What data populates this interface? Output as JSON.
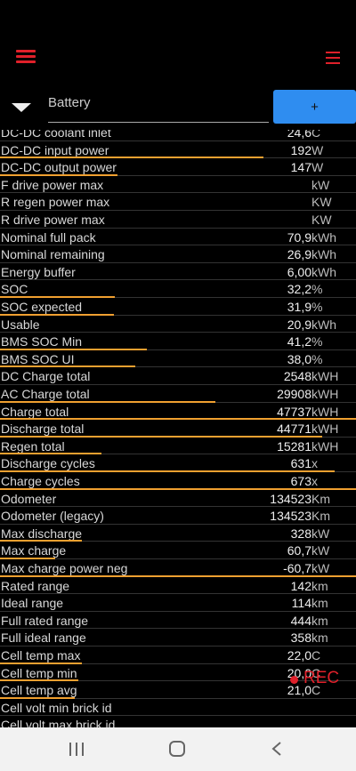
{
  "selector": {
    "current": "Battery",
    "add_label": "+"
  },
  "rows": [
    {
      "label": "DC-DC coolant inlet",
      "value": "24,6",
      "unit": "C",
      "bar": 0
    },
    {
      "label": "DC-DC input power",
      "value": "192",
      "unit": "W",
      "bar": 0.74
    },
    {
      "label": "DC-DC output power",
      "value": "147",
      "unit": "W",
      "bar": 0.33
    },
    {
      "label": "F drive power max",
      "value": "",
      "unit": "kW",
      "bar": 0
    },
    {
      "label": "R regen power max",
      "value": "",
      "unit": "KW",
      "bar": 0
    },
    {
      "label": "R drive power max",
      "value": "",
      "unit": "KW",
      "bar": 0
    },
    {
      "label": "Nominal full pack",
      "value": "70,9",
      "unit": "kWh",
      "bar": 0
    },
    {
      "label": "Nominal remaining",
      "value": "26,9",
      "unit": "kWh",
      "bar": 0
    },
    {
      "label": "Energy buffer",
      "value": "6,00",
      "unit": "kWh",
      "bar": 0
    },
    {
      "label": "SOC",
      "value": "32,2",
      "unit": "%",
      "bar": 0.322
    },
    {
      "label": "SOC expected",
      "value": "31,9",
      "unit": "%",
      "bar": 0.319
    },
    {
      "label": "Usable",
      "value": "20,9",
      "unit": "kWh",
      "bar": 0
    },
    {
      "label": "BMS SOC Min",
      "value": "41,2",
      "unit": "%",
      "bar": 0.412
    },
    {
      "label": "BMS SOC UI",
      "value": "38,0",
      "unit": "%",
      "bar": 0.38
    },
    {
      "label": "DC Charge total",
      "value": "2548",
      "unit": "kWH",
      "bar": 0
    },
    {
      "label": "AC Charge total",
      "value": "29908",
      "unit": "kWH",
      "bar": 0.605
    },
    {
      "label": "Charge total",
      "value": "47737",
      "unit": "kWH",
      "bar": 1.0
    },
    {
      "label": "Discharge total",
      "value": "44771",
      "unit": "kWH",
      "bar": 0.905
    },
    {
      "label": "Regen total",
      "value": "15281",
      "unit": "kWH",
      "bar": 0.285
    },
    {
      "label": "Discharge cycles",
      "value": "631",
      "unit": "x",
      "bar": 0.94
    },
    {
      "label": "Charge cycles",
      "value": "673",
      "unit": "x",
      "bar": 1.0
    },
    {
      "label": "Odometer",
      "value": "134523",
      "unit": "Km",
      "bar": 0
    },
    {
      "label": "Odometer (legacy)",
      "value": "134523",
      "unit": "Km",
      "bar": 0
    },
    {
      "label": "Max discharge",
      "value": "328",
      "unit": "kW",
      "bar": 0.23
    },
    {
      "label": "Max charge",
      "value": "60,7",
      "unit": "kW",
      "bar": 0.155
    },
    {
      "label": "Max charge power neg",
      "value": "-60,7",
      "unit": "kW",
      "bar": 1.0
    },
    {
      "label": "Rated range",
      "value": "142",
      "unit": "km",
      "bar": 0
    },
    {
      "label": "Ideal range",
      "value": "114",
      "unit": "km",
      "bar": 0
    },
    {
      "label": "Full rated range",
      "value": "444",
      "unit": "km",
      "bar": 0
    },
    {
      "label": "Full ideal range",
      "value": "358",
      "unit": "km",
      "bar": 0
    },
    {
      "label": "Cell temp max",
      "value": "22,0",
      "unit": "C",
      "bar": 0.23
    },
    {
      "label": "Cell temp min",
      "value": "20,0",
      "unit": "C",
      "bar": 0.22
    },
    {
      "label": "Cell temp avg",
      "value": "21,0",
      "unit": "C",
      "bar": 0.21
    },
    {
      "label": "Cell volt min brick id",
      "value": "",
      "unit": "",
      "bar": 0
    },
    {
      "label": "Cell volt max brick id",
      "value": "",
      "unit": "",
      "bar": 0
    }
  ],
  "recording": {
    "label": "REC"
  },
  "colors": {
    "accent_red": "#e0202a",
    "bar_orange": "#f0a030",
    "button_blue": "#2f8df0"
  }
}
